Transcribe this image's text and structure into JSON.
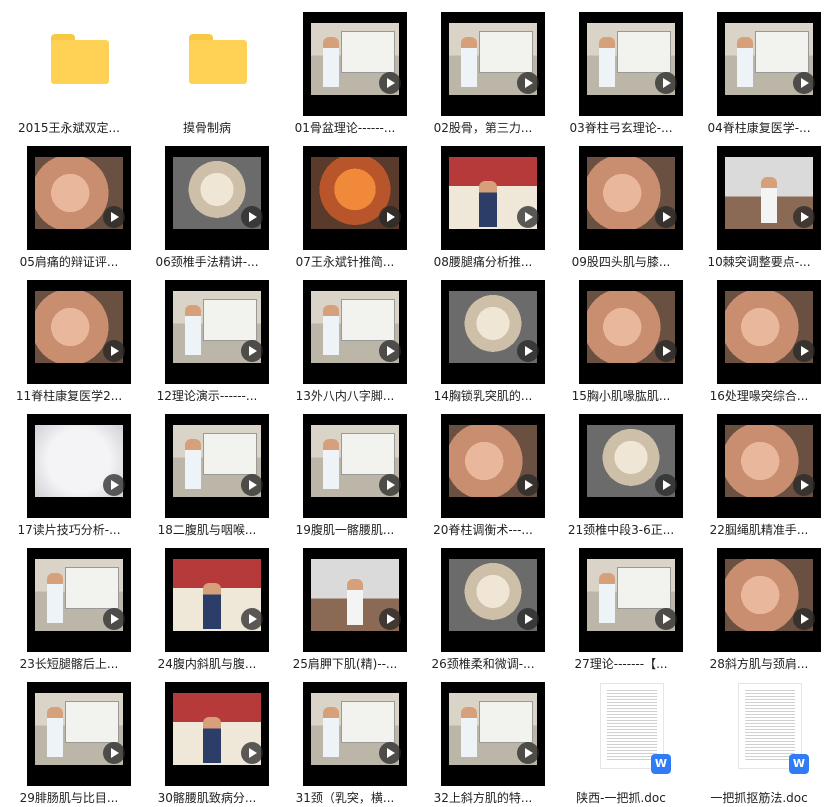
{
  "items": [
    {
      "type": "folder",
      "label": "2015王永斌双定..."
    },
    {
      "type": "folder",
      "label": "摸骨制病"
    },
    {
      "type": "video",
      "scene": "class",
      "label": "01骨盆理论------..."
    },
    {
      "type": "video",
      "scene": "class",
      "label": "02股骨，第三力..."
    },
    {
      "type": "video",
      "scene": "class",
      "label": "03脊柱弓玄理论-..."
    },
    {
      "type": "video",
      "scene": "class",
      "label": "04脊柱康复医学-..."
    },
    {
      "type": "video",
      "scene": "hands",
      "label": "05肩痛的辩证评..."
    },
    {
      "type": "video",
      "scene": "skel",
      "label": "06颈椎手法精讲-..."
    },
    {
      "type": "video",
      "scene": "orange",
      "label": "07王永斌针推简..."
    },
    {
      "type": "video",
      "scene": "red",
      "label": "08腰腿痛分析推..."
    },
    {
      "type": "video",
      "scene": "hands",
      "label": "09股四头肌与膝..."
    },
    {
      "type": "video",
      "scene": "room",
      "label": "10棘突调整要点-..."
    },
    {
      "type": "video",
      "scene": "hands",
      "label": "11脊柱康复医学2..."
    },
    {
      "type": "video",
      "scene": "class",
      "label": "12理论演示------..."
    },
    {
      "type": "video",
      "scene": "class",
      "label": "13外八内八字脚..."
    },
    {
      "type": "video",
      "scene": "skel",
      "label": "14胸锁乳突肌的..."
    },
    {
      "type": "video",
      "scene": "hands",
      "label": "15胸小肌喙肱肌..."
    },
    {
      "type": "video",
      "scene": "hands",
      "label": "16处理喙突综合..."
    },
    {
      "type": "video",
      "scene": "white",
      "label": "17读片技巧分析-..."
    },
    {
      "type": "video",
      "scene": "class",
      "label": "18二腹肌与咽喉..."
    },
    {
      "type": "video",
      "scene": "class",
      "label": "19腹肌一髂腰肌..."
    },
    {
      "type": "video",
      "scene": "hands",
      "label": "20脊柱调衡术---..."
    },
    {
      "type": "video",
      "scene": "skel",
      "label": "21颈椎中段3-6正..."
    },
    {
      "type": "video",
      "scene": "hands",
      "label": "22腘绳肌精准手..."
    },
    {
      "type": "video",
      "scene": "class",
      "label": "23长短腿髂后上..."
    },
    {
      "type": "video",
      "scene": "red",
      "label": "24腹内斜肌与腹..."
    },
    {
      "type": "video",
      "scene": "room",
      "label": "25肩胛下肌(精)--..."
    },
    {
      "type": "video",
      "scene": "skel",
      "label": "26颈椎柔和微调-..."
    },
    {
      "type": "video",
      "scene": "class",
      "label": "27理论-------【..."
    },
    {
      "type": "video",
      "scene": "hands",
      "label": "28斜方肌与颈肩..."
    },
    {
      "type": "video",
      "scene": "class",
      "label": "29腓肠肌与比目..."
    },
    {
      "type": "video",
      "scene": "red",
      "label": "30髂腰肌致病分..."
    },
    {
      "type": "video",
      "scene": "class",
      "label": "31颈（乳突，横..."
    },
    {
      "type": "video",
      "scene": "class",
      "label": "32上斜方肌的特..."
    },
    {
      "type": "doc",
      "label": "陕西-一把抓.doc"
    },
    {
      "type": "doc",
      "label": "一把抓抠筋法.doc"
    }
  ],
  "doc_badge": "W",
  "colors": {
    "folder": "#ffd256",
    "doc_badge": "#2f7cf6"
  }
}
